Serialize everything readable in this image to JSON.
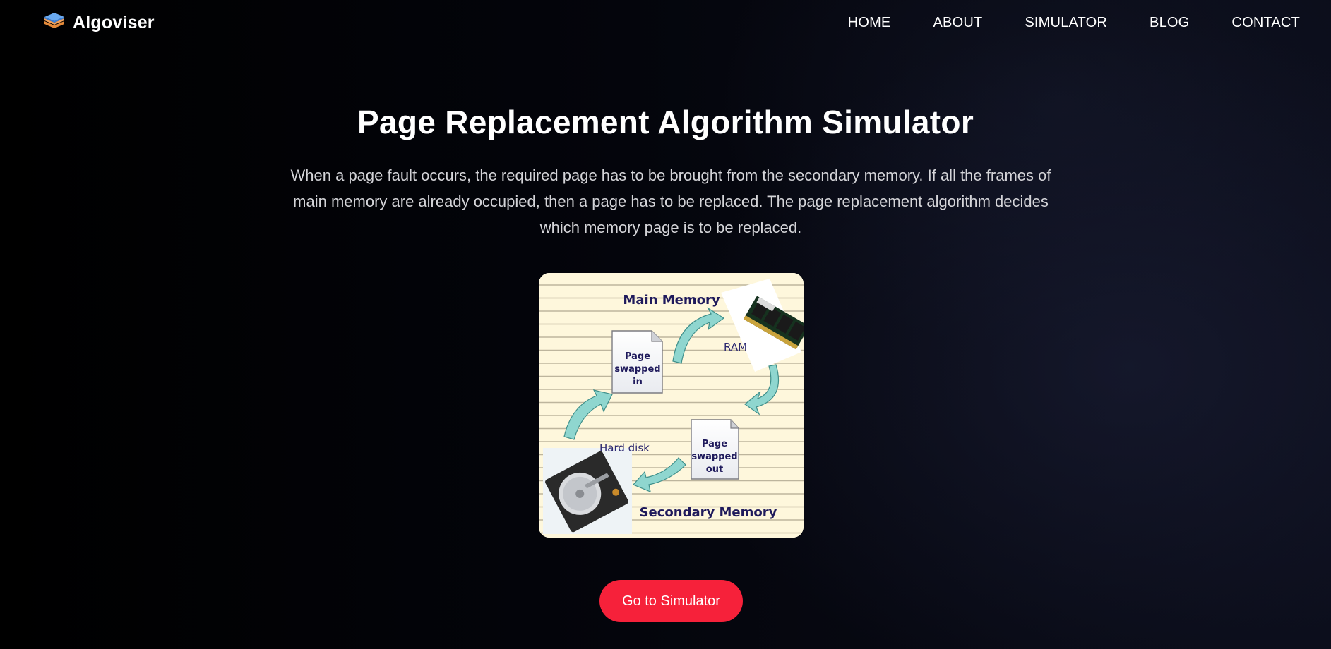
{
  "brand": {
    "name": "Algoviser",
    "logo_icon": "layers-icon"
  },
  "nav": {
    "items": [
      {
        "label": "HOME"
      },
      {
        "label": "ABOUT"
      },
      {
        "label": "SIMULATOR"
      },
      {
        "label": "BLOG"
      },
      {
        "label": "CONTACT"
      }
    ]
  },
  "hero": {
    "title": "Page Replacement Algorithm Simulator",
    "description": "When a page fault occurs, the required page has to be brought from the secondary memory. If all the frames of main memory are already occupied, then a page has to be replaced. The page replacement algorithm decides which memory page is to be replaced.",
    "cta_label": "Go to Simulator"
  },
  "diagram": {
    "main_memory": "Main Memory",
    "secondary_memory": "Secondary Memory",
    "ram": "RAM",
    "hard_disk": "Hard disk",
    "page_in_lines": [
      "Page",
      "swapped",
      "in"
    ],
    "page_out_lines": [
      "Page",
      "swapped",
      "out"
    ]
  },
  "colors": {
    "cta": "#f6213a",
    "diagram_bg": "#fef7dc",
    "diagram_text": "#1f1a5c",
    "arrow": "#8fd6cf",
    "logo_top": "#6aa9f0",
    "logo_mid": "#f0a05a",
    "logo_bottom": "#e58a3a"
  }
}
